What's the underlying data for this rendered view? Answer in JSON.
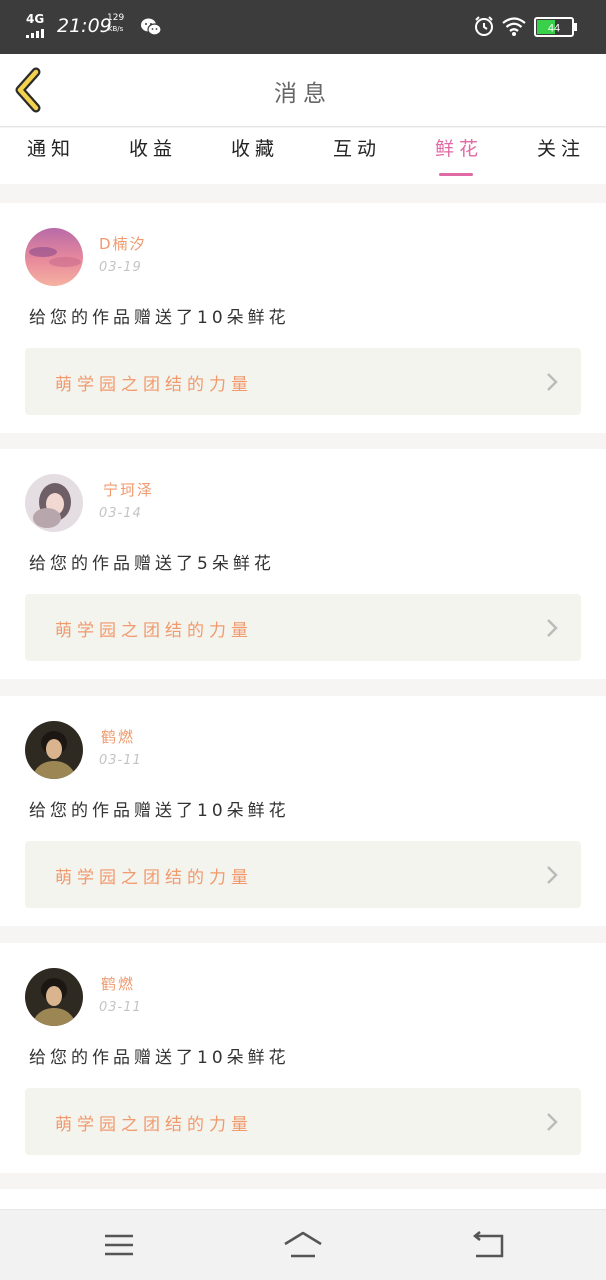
{
  "status_bar": {
    "network": "4G",
    "time": "21:09",
    "speed_value": "129",
    "speed_unit": "KB/s",
    "battery_label": "44",
    "battery_color": "#3ad14a"
  },
  "header": {
    "title": "消息",
    "back_icon": "chevron-left-icon"
  },
  "tabs": [
    {
      "label": "通知",
      "active": false
    },
    {
      "label": "收益",
      "active": false
    },
    {
      "label": "收藏",
      "active": false
    },
    {
      "label": "互动",
      "active": false
    },
    {
      "label": "鲜花",
      "active": true
    },
    {
      "label": "关注",
      "active": false
    }
  ],
  "colors": {
    "accent": "#e06aa4",
    "name": "#f09a6e",
    "date": "#c4c4c4",
    "link_bg": "#f4f4ee"
  },
  "notifications": [
    {
      "user": "D楠汐",
      "date": "03-19",
      "message": "给您的作品赠送了10朵鲜花",
      "work_title": "萌学园之团结的力量"
    },
    {
      "user": "宁珂泽",
      "date": "03-14",
      "message": "给您的作品赠送了5朵鲜花",
      "work_title": "萌学园之团结的力量"
    },
    {
      "user": "鹤燃",
      "date": "03-11",
      "message": "给您的作品赠送了10朵鲜花",
      "work_title": "萌学园之团结的力量"
    },
    {
      "user": "鹤燃",
      "date": "03-11",
      "message": "给您的作品赠送了10朵鲜花",
      "work_title": "萌学园之团结的力量"
    }
  ],
  "bottom_nav": {
    "menu_icon": "menu-icon",
    "home_icon": "home-icon",
    "back_icon": "back-icon"
  }
}
